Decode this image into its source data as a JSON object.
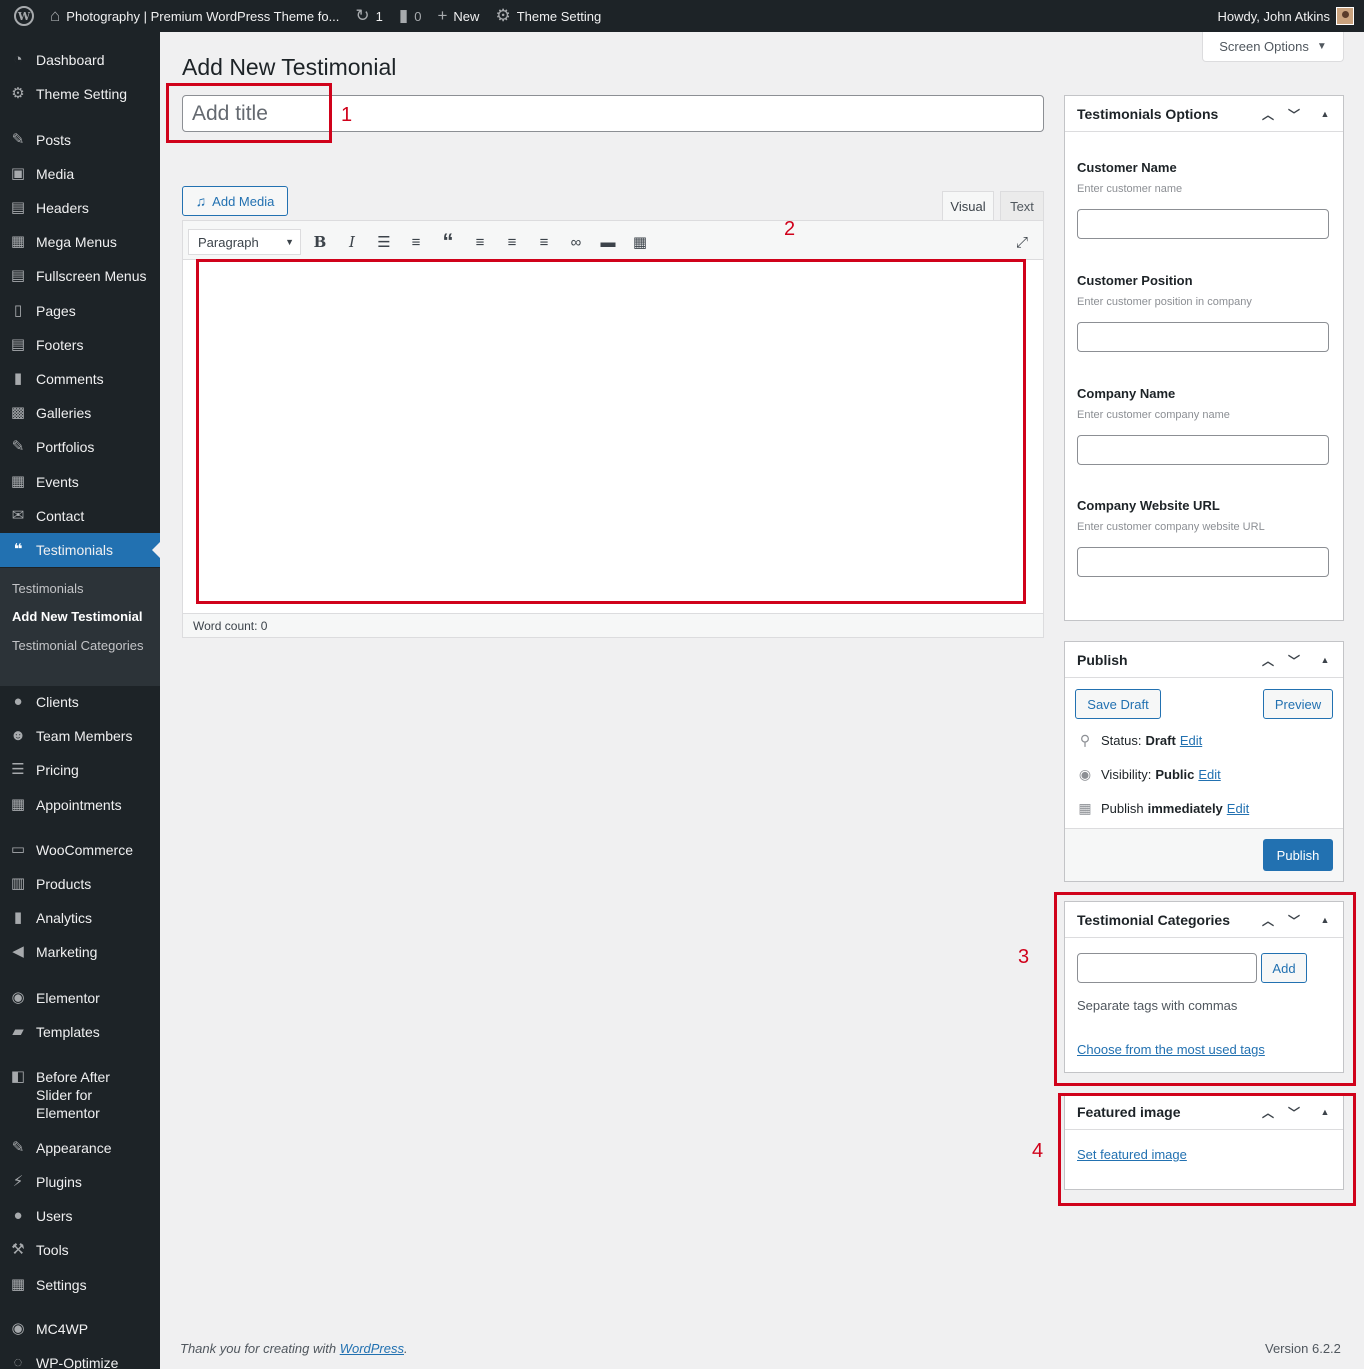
{
  "admin_bar": {
    "site_name": "Photography | Premium WordPress Theme fo...",
    "updates_count": "1",
    "comments_count": "0",
    "new_label": "New",
    "theme_setting_label": "Theme Setting",
    "howdy": "Howdy, John Atkins"
  },
  "sidebar": {
    "items": [
      {
        "label": "Dashboard",
        "icon": "dashboard-icon"
      },
      {
        "label": "Theme Setting",
        "icon": "gear-icon"
      },
      {
        "label": "Posts",
        "icon": "pin-icon"
      },
      {
        "label": "Media",
        "icon": "media-icon"
      },
      {
        "label": "Headers",
        "icon": "headers-icon"
      },
      {
        "label": "Mega Menus",
        "icon": "mega-menus-icon"
      },
      {
        "label": "Fullscreen Menus",
        "icon": "fullscreen-menus-icon"
      },
      {
        "label": "Pages",
        "icon": "pages-icon"
      },
      {
        "label": "Footers",
        "icon": "footers-icon"
      },
      {
        "label": "Comments",
        "icon": "comments-icon"
      },
      {
        "label": "Galleries",
        "icon": "galleries-icon"
      },
      {
        "label": "Portfolios",
        "icon": "portfolios-icon"
      },
      {
        "label": "Events",
        "icon": "calendar-icon"
      },
      {
        "label": "Contact",
        "icon": "envelope-icon"
      },
      {
        "label": "Testimonials",
        "icon": "quote-icon"
      },
      {
        "label": "Clients",
        "icon": "user-icon"
      },
      {
        "label": "Team Members",
        "icon": "groups-icon"
      },
      {
        "label": "Pricing",
        "icon": "list-icon"
      },
      {
        "label": "Appointments",
        "icon": "calendar-icon"
      },
      {
        "label": "WooCommerce",
        "icon": "woocommerce-icon"
      },
      {
        "label": "Products",
        "icon": "archive-icon"
      },
      {
        "label": "Analytics",
        "icon": "chart-bar-icon"
      },
      {
        "label": "Marketing",
        "icon": "megaphone-icon"
      },
      {
        "label": "Elementor",
        "icon": "elementor-icon"
      },
      {
        "label": "Templates",
        "icon": "folder-icon"
      },
      {
        "label": "Before After Slider for Elementor",
        "icon": "before-after-icon"
      },
      {
        "label": "Appearance",
        "icon": "brush-icon"
      },
      {
        "label": "Plugins",
        "icon": "plug-icon"
      },
      {
        "label": "Users",
        "icon": "user-icon"
      },
      {
        "label": "Tools",
        "icon": "wrench-icon"
      },
      {
        "label": "Settings",
        "icon": "sliders-icon"
      },
      {
        "label": "MC4WP",
        "icon": "mc4wp-icon"
      },
      {
        "label": "WP-Optimize",
        "icon": "optimize-icon"
      }
    ],
    "submenu": {
      "items": [
        "Testimonials",
        "Add New Testimonial",
        "Testimonial Categories"
      ]
    }
  },
  "main": {
    "screen_options": "Screen Options",
    "page_title": "Add New Testimonial",
    "title_placeholder": "Add title",
    "add_media": "Add Media",
    "tab_visual": "Visual",
    "tab_text": "Text",
    "format_select": "Paragraph",
    "word_count": "Word count: 0"
  },
  "testimonial_options": {
    "title": "Testimonials Options",
    "fields": [
      {
        "label": "Customer Name",
        "hint": "Enter customer name",
        "value": ""
      },
      {
        "label": "Customer Position",
        "hint": "Enter customer position in company",
        "value": ""
      },
      {
        "label": "Company Name",
        "hint": "Enter customer company name",
        "value": ""
      },
      {
        "label": "Company Website URL",
        "hint": "Enter customer company website URL",
        "value": ""
      }
    ]
  },
  "publish": {
    "title": "Publish",
    "save_draft": "Save Draft",
    "preview": "Preview",
    "status_label": "Status:",
    "status_value": "Draft",
    "visibility_label": "Visibility:",
    "visibility_value": "Public",
    "publish_label": "Publish",
    "publish_value": "immediately",
    "edit": "Edit",
    "publish_button": "Publish"
  },
  "categories": {
    "title": "Testimonial Categories",
    "add_button": "Add",
    "help": "Separate tags with commas",
    "choose_link": "Choose from the most used tags"
  },
  "featured_image": {
    "title": "Featured image",
    "set_link": "Set featured image"
  },
  "footer": {
    "thanks_prefix": "Thank you for creating with ",
    "thanks_link": "WordPress",
    "thanks_suffix": ".",
    "version": "Version 6.2.2"
  },
  "annotations": [
    "1",
    "2",
    "3",
    "4"
  ],
  "colors": {
    "admin_dark": "#1d2327",
    "accent": "#2271b1",
    "annotation_red": "#d0021b"
  }
}
